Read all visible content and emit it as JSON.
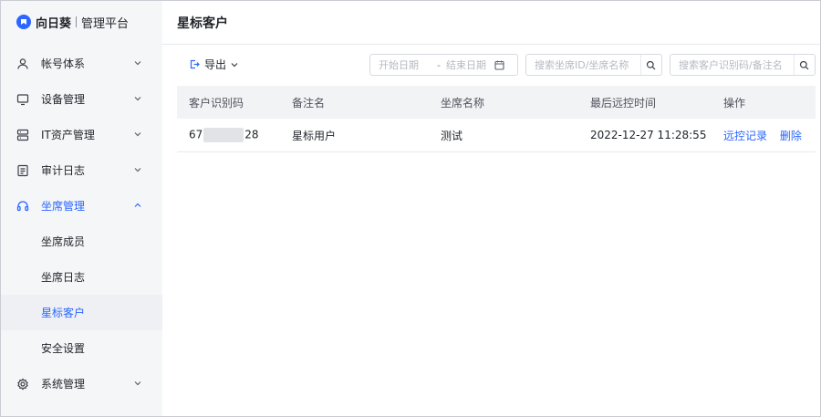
{
  "brand": {
    "name": "向日葵",
    "subtitle": "管理平台"
  },
  "sidebar": {
    "items": [
      {
        "label": "帐号体系",
        "icon": "user-icon"
      },
      {
        "label": "设备管理",
        "icon": "monitor-icon"
      },
      {
        "label": "IT资产管理",
        "icon": "server-icon"
      },
      {
        "label": "审计日志",
        "icon": "log-icon"
      },
      {
        "label": "坐席管理",
        "icon": "headset-icon",
        "open": true,
        "children": [
          {
            "label": "坐席成员"
          },
          {
            "label": "坐席日志"
          },
          {
            "label": "星标客户",
            "active": true
          },
          {
            "label": "安全设置"
          }
        ]
      },
      {
        "label": "系统管理",
        "icon": "gear-icon"
      }
    ]
  },
  "header": {
    "title": "星标客户"
  },
  "toolbar": {
    "export_label": "导出",
    "date_start_placeholder": "开始日期",
    "date_end_placeholder": "结束日期",
    "date_separator": "-",
    "search_seat_placeholder": "搜索坐席ID/坐席名称",
    "search_customer_placeholder": "搜索客户识别码/备注名"
  },
  "table": {
    "columns": [
      "客户识别码",
      "备注名",
      "坐席名称",
      "最后远控时间",
      "操作"
    ],
    "rows": [
      {
        "code_prefix": "67",
        "code_suffix": "28",
        "remark": "星标用户",
        "seat": "测试",
        "last_time": "2022-12-27 11:28:55",
        "actions": [
          "远控记录",
          "删除"
        ]
      }
    ]
  },
  "colors": {
    "accent": "#2a66ff",
    "sidebar_bg": "#f5f6f8",
    "table_header_bg": "#f2f3f5"
  }
}
